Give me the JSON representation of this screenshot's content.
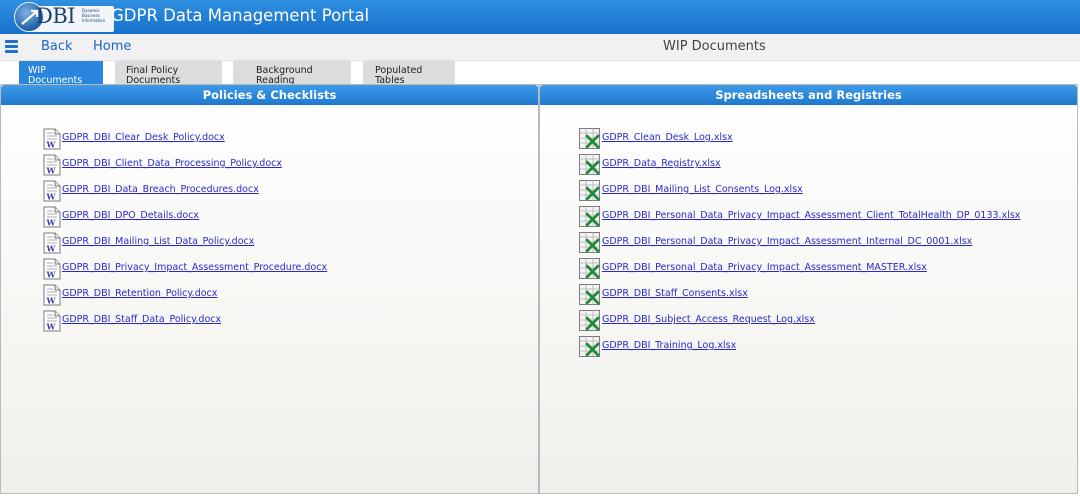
{
  "header": {
    "logo_text": "DBI",
    "logo_subtext": "Dynamic Business Information",
    "title": "GDPR Data Management Portal"
  },
  "nav": {
    "back_label": "Back",
    "home_label": "Home",
    "page_heading": "WIP Documents"
  },
  "tabs": [
    {
      "label": "WIP Documents",
      "active": true
    },
    {
      "label": "Final Policy Documents",
      "active": false
    },
    {
      "label": "Background Reading",
      "active": false
    },
    {
      "label": "Populated Tables",
      "active": false
    }
  ],
  "left_panel": {
    "title": "Policies & Checklists",
    "icon": "word-document-icon",
    "files": [
      "GDPR_DBI_Clear_Desk_Policy.docx",
      "GDPR_DBI_Client_Data_Processing_Policy.docx",
      "GDPR_DBI_Data_Breach_Procedures.docx",
      "GDPR_DBI_DPO_Details.docx",
      "GDPR_DBI_Mailing_List_Data_Policy.docx",
      "GDPR_DBI_Privacy_Impact_Assessment_Procedure.docx",
      "GDPR_DBI_Retention_Policy.docx",
      "GDPR_DBI_Staff_Data_Policy.docx"
    ]
  },
  "right_panel": {
    "title": "Spreadsheets and Registries",
    "icon": "excel-spreadsheet-icon",
    "files": [
      "GDPR_Clean_Desk_Log.xlsx",
      "GDPR_Data_Registry.xlsx",
      "GDPR_DBI_Mailing_List_Consents_Log.xlsx",
      "GDPR_DBI_Personal_Data_Privacy_Impact_Assessment_Client_TotalHealth_DP_0133.xlsx",
      "GDPR_DBI_Personal_Data_Privacy_Impact_Assessment_Internal_DC_0001.xlsx",
      "GDPR_DBI_Personal_Data_Privacy_Impact_Assessment_MASTER.xlsx",
      "GDPR_DBI_Staff_Consents.xlsx",
      "GDPR_DBI_Subject_Access_Request_Log.xlsx",
      "GDPR_DBI_Training_Log.xlsx"
    ]
  },
  "colors": {
    "header_blue": "#1f78cf",
    "tab_active": "#2a86dc",
    "link_color": "#2a2acb"
  }
}
